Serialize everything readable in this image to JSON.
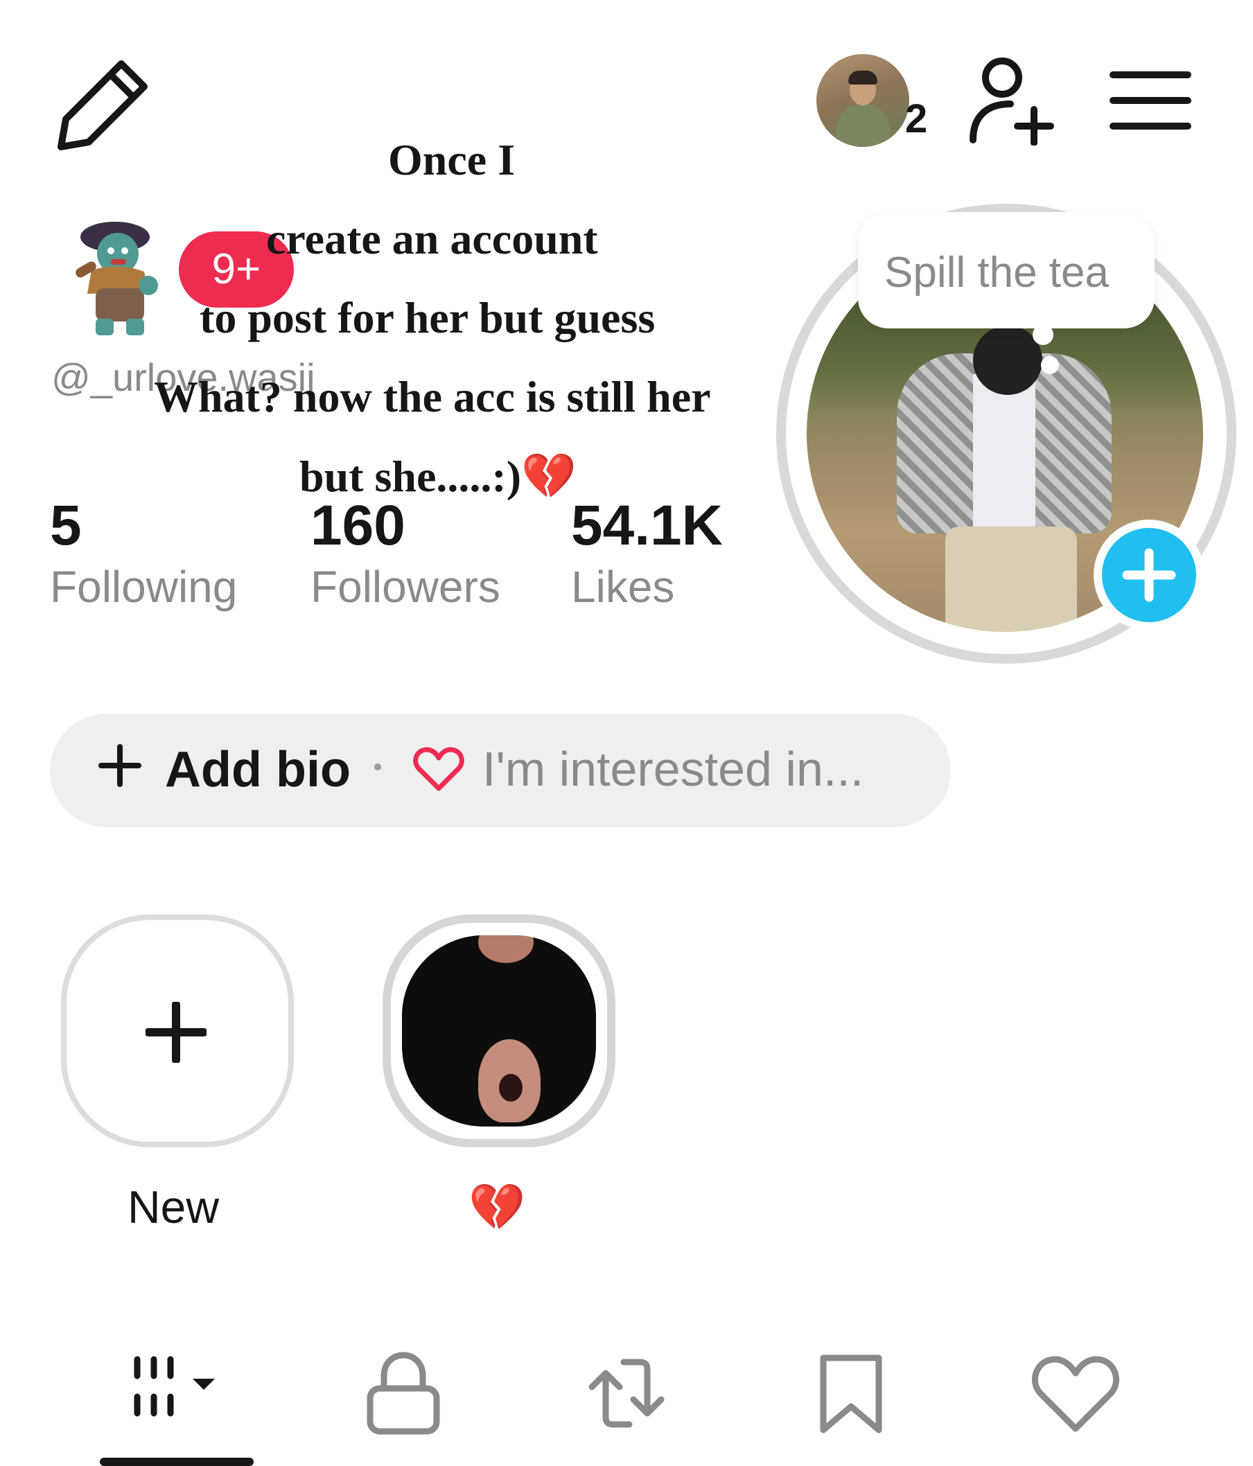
{
  "header": {
    "friends_count": "2"
  },
  "caption": {
    "line1": "Once I",
    "line2": "create an account",
    "line3": "to post for her but guess",
    "line4": "What? now the acc is still her",
    "line5": "but she.....:)💔"
  },
  "profile": {
    "notification_badge": "9+",
    "username": "@_urlove.wasii"
  },
  "stats": {
    "following": {
      "value": "5",
      "label": "Following"
    },
    "followers": {
      "value": "160",
      "label": "Followers"
    },
    "likes": {
      "value": "54.1K",
      "label": "Likes"
    }
  },
  "story": {
    "bubble_text": "Spill the tea"
  },
  "bio": {
    "add_label": "Add bio",
    "interest_label": "I'm interested in..."
  },
  "highlights": [
    {
      "label": "New"
    },
    {
      "label": "💔"
    }
  ],
  "tabs": [
    {
      "icon": "grid-icon",
      "active": true
    },
    {
      "icon": "lock-icon",
      "active": false
    },
    {
      "icon": "repost-icon",
      "active": false
    },
    {
      "icon": "bookmark-icon",
      "active": false
    },
    {
      "icon": "heart-icon",
      "active": false
    }
  ],
  "colors": {
    "badge": "#ee2b51",
    "accent": "#21bff0",
    "muted_text": "#8a8a8a"
  }
}
